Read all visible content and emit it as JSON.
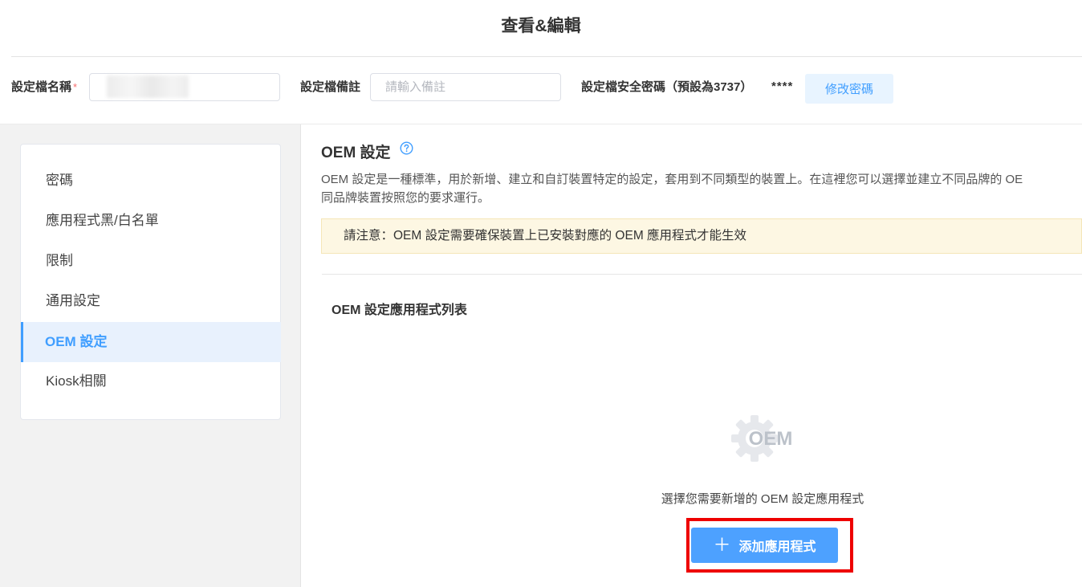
{
  "page": {
    "title": "查看&編輯"
  },
  "form": {
    "name_label": "設定檔名稱",
    "required_mark": "*",
    "note_label": "設定檔備註",
    "note_placeholder": "請輸入備註",
    "password_label": "設定檔安全密碼（預設為3737）",
    "password_mask": "****",
    "change_password_button": "修改密碼"
  },
  "sidebar": {
    "items": [
      {
        "label": "密碼"
      },
      {
        "label": "應用程式黑/白名單"
      },
      {
        "label": "限制"
      },
      {
        "label": "通用設定"
      },
      {
        "label": "OEM 設定",
        "active": true
      },
      {
        "label": "Kiosk相關"
      }
    ]
  },
  "main": {
    "section_title": "OEM 設定",
    "help_icon": "question-circle-icon",
    "description_line1": "OEM 設定是一種標準，用於新增、建立和自訂裝置特定的設定，套用到不同類型的裝置上。在這裡您可以選擇並建立不同品牌的 OE",
    "description_line2": "同品牌裝置按照您的要求運行。",
    "notice": "請注意：OEM 設定需要確保裝置上已安裝對應的 OEM 應用程式才能生效",
    "list_title": "OEM 設定應用程式列表",
    "empty_icon": "oem-gear-icon",
    "empty_icon_text": "OEM",
    "empty_text": "選擇您需要新增的 OEM 設定應用程式",
    "add_button_icon": "plus-icon",
    "add_button_label": "添加應用程式"
  },
  "colors": {
    "accent": "#409eff",
    "button_primary": "#4da1ff",
    "notice_bg": "#fdf7e3",
    "highlight": "#ee0000"
  }
}
